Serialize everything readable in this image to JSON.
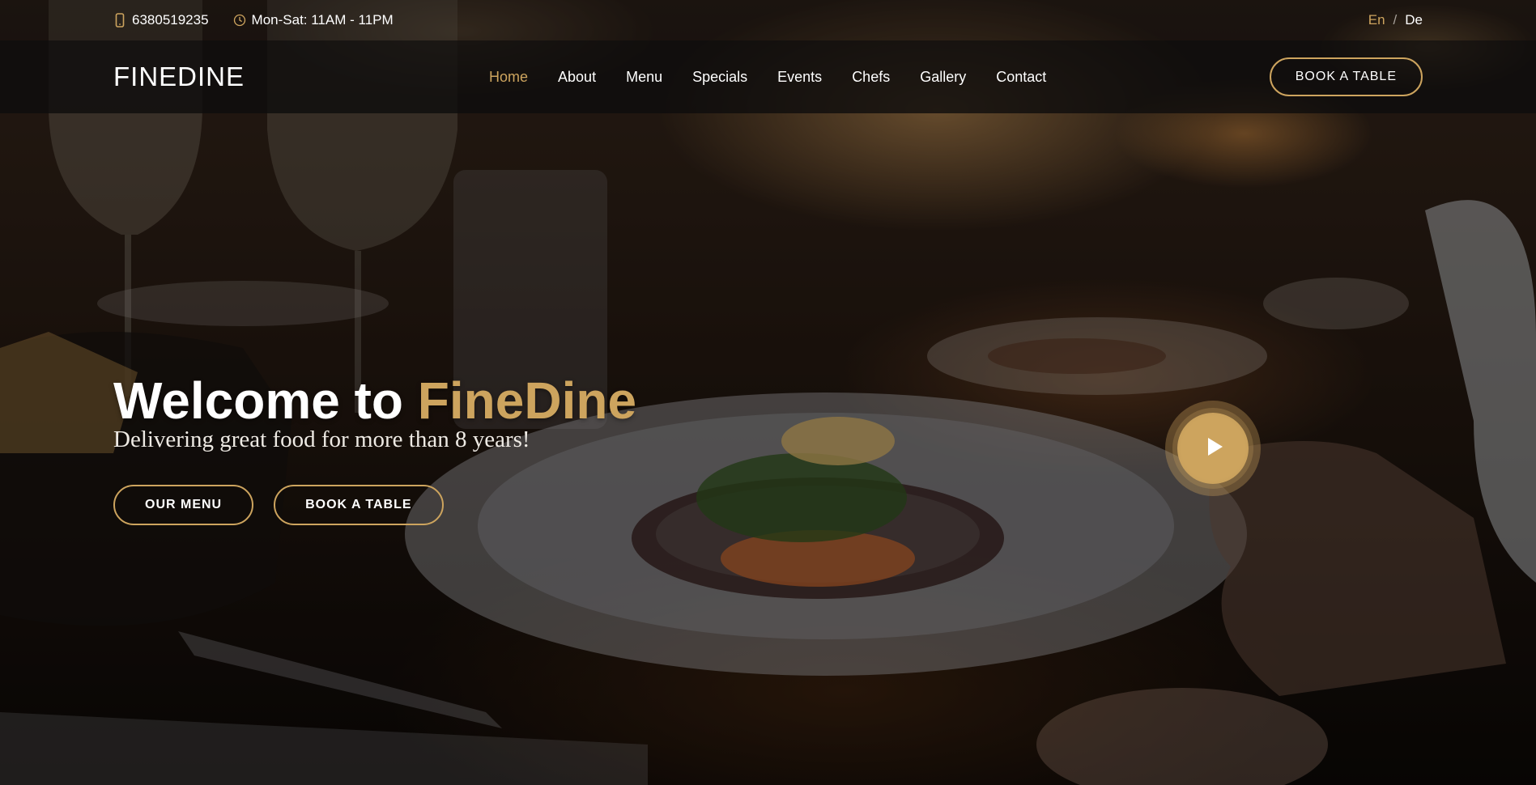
{
  "topbar": {
    "phone": "6380519235",
    "phone_icon": "phone-icon",
    "hours": "Mon-Sat: 11AM - 11PM",
    "hours_icon": "clock-icon",
    "lang_en": "En",
    "lang_separator": "/",
    "lang_de": "De"
  },
  "header": {
    "logo": "FINEDINE",
    "nav": [
      {
        "label": "Home",
        "active": true
      },
      {
        "label": "About"
      },
      {
        "label": "Menu"
      },
      {
        "label": "Specials"
      },
      {
        "label": "Events"
      },
      {
        "label": "Chefs"
      },
      {
        "label": "Gallery"
      },
      {
        "label": "Contact"
      }
    ],
    "book_label": "BOOK A TABLE"
  },
  "hero": {
    "title_prefix": "Welcome to",
    "title_brand": "FineDine",
    "subtitle": "Delivering great food for more than 8 years!",
    "btn_menu": "OUR MENU",
    "btn_book": "BOOK A TABLE",
    "play_icon": "play-icon"
  },
  "colors": {
    "accent": "#cda45e",
    "text": "#ffffff",
    "header_bg": "#0e0d0c"
  }
}
